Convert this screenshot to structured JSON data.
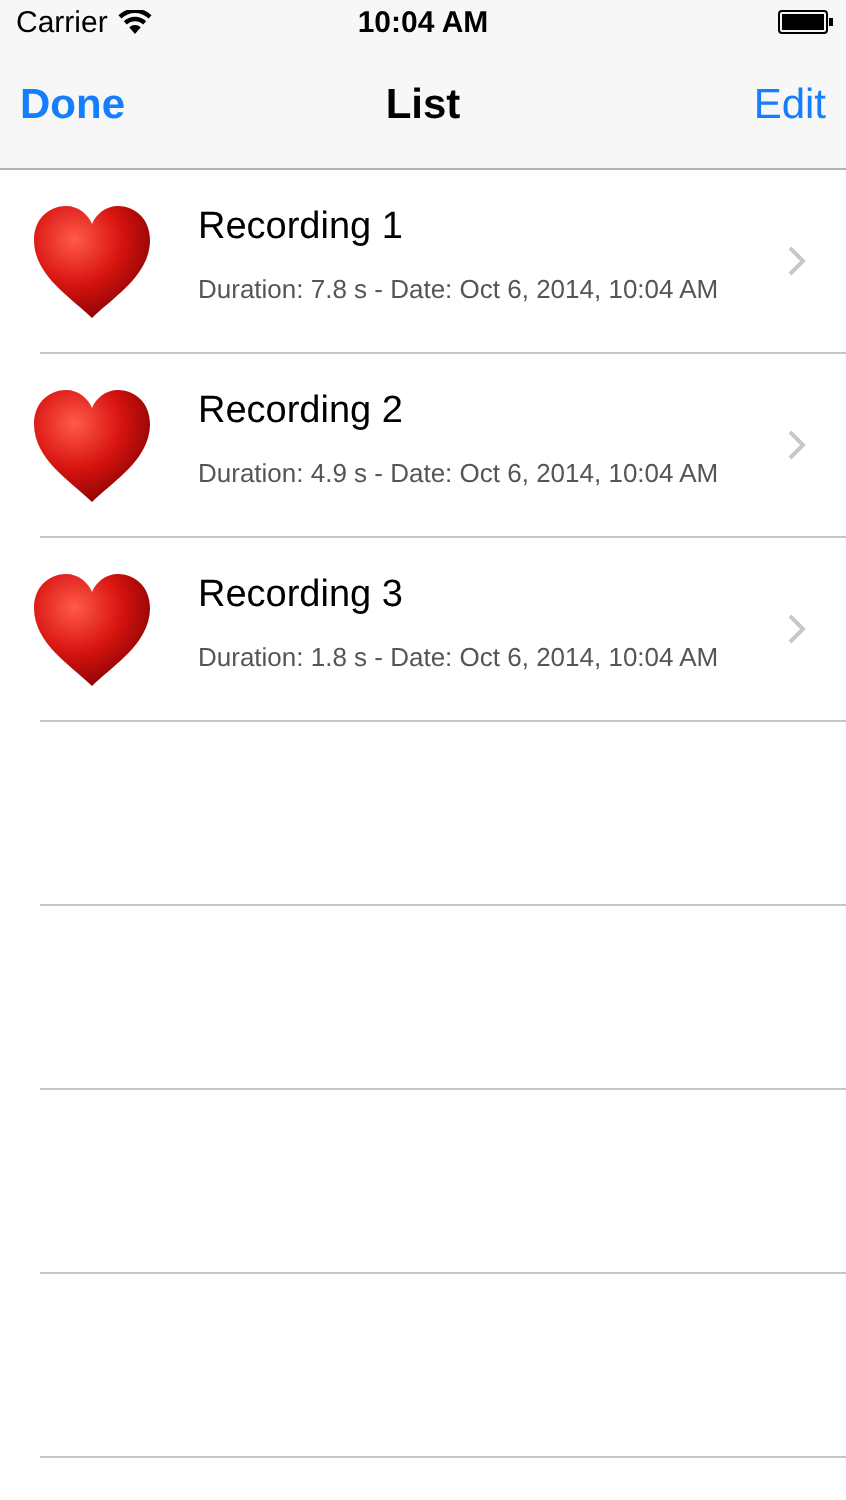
{
  "status_bar": {
    "carrier": "Carrier",
    "time": "10:04 AM"
  },
  "nav_bar": {
    "left_button": "Done",
    "title": "List",
    "right_button": "Edit"
  },
  "recordings": [
    {
      "title": "Recording 1",
      "details": "Duration: 7.8 s - Date: Oct 6, 2014, 10:04 AM"
    },
    {
      "title": "Recording 2",
      "details": "Duration: 4.9 s - Date: Oct 6, 2014, 10:04 AM"
    },
    {
      "title": "Recording 3",
      "details": "Duration: 1.8 s - Date: Oct 6, 2014, 10:04 AM"
    }
  ]
}
